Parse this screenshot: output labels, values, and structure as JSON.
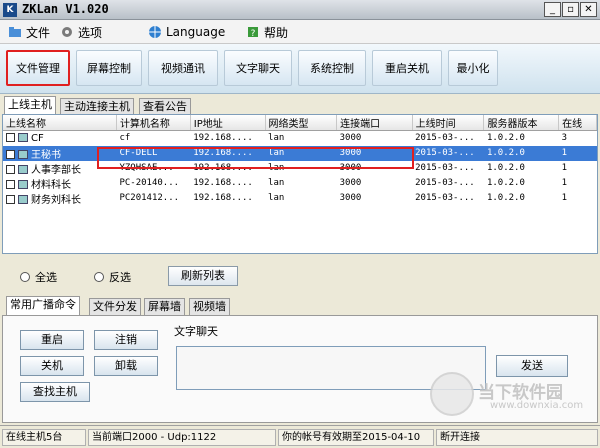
{
  "window": {
    "title": "ZKLan V1.020",
    "controls": [
      "_",
      "▫",
      "✕"
    ]
  },
  "menu": [
    {
      "label": "文件",
      "icon": "folder-icon"
    },
    {
      "label": "选项",
      "icon": "options-icon"
    },
    {
      "label": "Language",
      "icon": "globe-icon"
    },
    {
      "label": "帮助",
      "icon": "help-icon"
    }
  ],
  "toolbar": [
    "文件管理",
    "屏幕控制",
    "视频通讯",
    "文字聊天",
    "系统控制",
    "重启关机",
    "最小化"
  ],
  "host_tabs": [
    "上线主机",
    "主动连接主机",
    "查看公告"
  ],
  "table": {
    "headers": [
      "上线名称",
      "计算机名称",
      "IP地址",
      "网络类型",
      "连接端口",
      "上线时间",
      "服务器版本",
      "在线"
    ],
    "rows": [
      [
        "CF",
        "cf",
        "192.168....",
        "lan",
        "3000",
        "2015-03-...",
        "1.0.2.0",
        "3"
      ],
      [
        "王秘书",
        "CF-DELL",
        "192.168....",
        "lan",
        "3000",
        "2015-03-...",
        "1.0.2.0",
        "1"
      ],
      [
        "人事李部长",
        "YZQHSAE...",
        "192.168....",
        "lan",
        "3000",
        "2015-03-...",
        "1.0.2.0",
        "1"
      ],
      [
        "材料科长",
        "PC-20140...",
        "192.168....",
        "lan",
        "3000",
        "2015-03-...",
        "1.0.2.0",
        "1"
      ],
      [
        "财务刘科长",
        "PC201412...",
        "192.168....",
        "lan",
        "3000",
        "2015-03-...",
        "1.0.2.0",
        "1"
      ]
    ]
  },
  "select_all": "全选",
  "invert_selection": "反选",
  "refresh": "刷新列表",
  "command_tabs": [
    "常用广播命令",
    "文件分发",
    "屏幕墙",
    "视频墙"
  ],
  "commands": [
    "重启",
    "注销",
    "关机",
    "卸载",
    "查找主机"
  ],
  "chat_label": "文字聊天",
  "send": "发送",
  "status": [
    "在线主机5台",
    "当前端口2000 - Udp:1122",
    "你的帐号有效期至2015-04-10",
    "断开连接"
  ],
  "watermark": {
    "text": "当下软件园",
    "url": "www.downxia.com"
  }
}
